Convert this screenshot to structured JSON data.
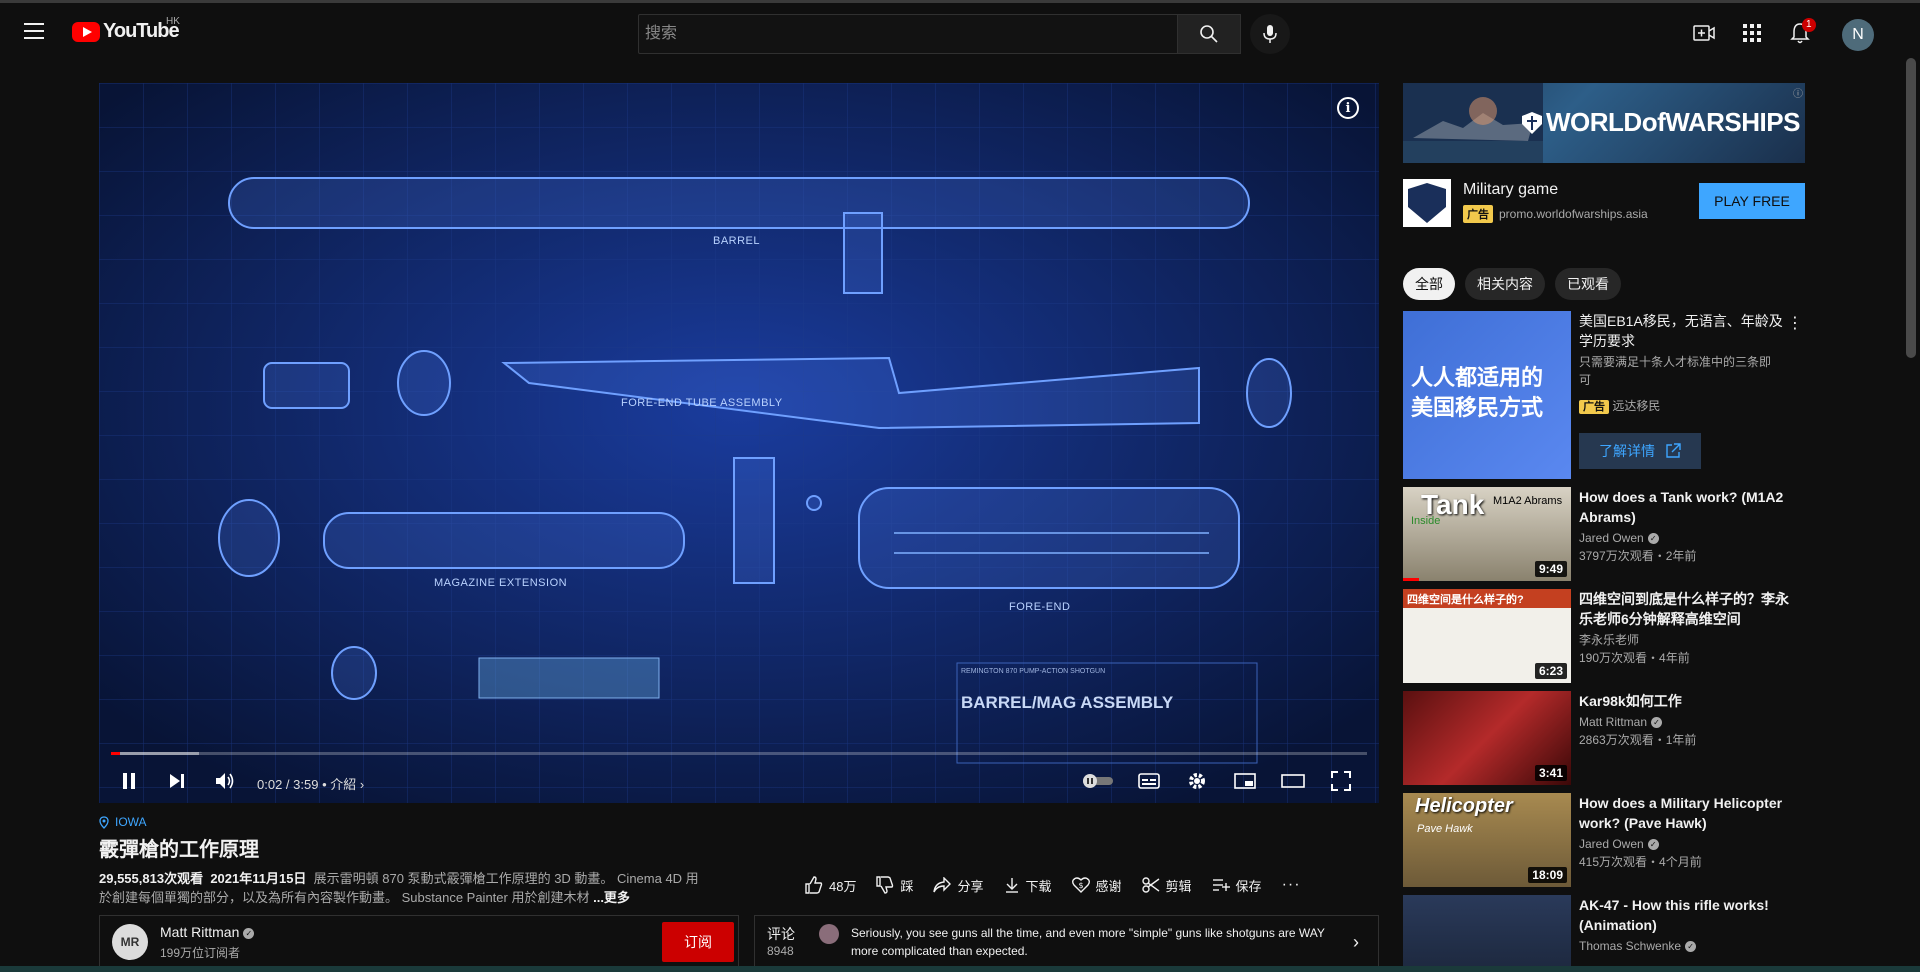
{
  "header": {
    "menu_icon": "hamburger-menu-icon",
    "logo_text": "YouTube",
    "country_code": "HK",
    "search_placeholder": "搜索",
    "notification_count": "1",
    "avatar_letter": "N"
  },
  "player": {
    "info_icon": "i",
    "blueprint_labels": {
      "barrel": "BARREL",
      "fore_end_tube": "FORE-END TUBE ASSEMBLY",
      "magazine_extension": "MAGAZINE EXTENSION",
      "fore_end": "FORE-END",
      "title_block_sub": "REMINGTON 870 PUMP-ACTION SHOTGUN",
      "title_block": "BARREL/MAG ASSEMBLY"
    },
    "time_current": "0:02",
    "time_total": "3:59",
    "chapter": "• 介紹",
    "progress_played": 0.007,
    "progress_loaded": 0.07
  },
  "video": {
    "location": "IOWA",
    "title": "霰彈槍的工作原理",
    "views": "29,555,813次观看",
    "date": "2021年11月15日",
    "description": "展示雷明頓 870 泵動式霰彈槍工作原理的 3D 動畫。 Cinema 4D 用於創建每個單獨的部分，以及為所有內容製作動畫。 Substance Painter 用於創建木材",
    "more_label": "...更多",
    "actions": {
      "like": "48万",
      "dislike": "踩",
      "share": "分享",
      "download": "下载",
      "thanks": "感谢",
      "clip": "剪辑",
      "save": "保存"
    }
  },
  "channel": {
    "name": "Matt Rittman",
    "subscribers": "199万位订阅者",
    "avatar_text": "MR",
    "subscribe_label": "订阅"
  },
  "comments": {
    "label": "评论",
    "count": "8948",
    "top_comment": "Seriously, you see guns all the time, and even more \"simple\" guns like shotguns are WAY more complicated than expected."
  },
  "ad": {
    "banner_text": "WORLDofWARSHIPS",
    "title": "Military game",
    "tag": "广告",
    "url": "promo.worldofwarships.asia",
    "cta": "PLAY FREE"
  },
  "chips": [
    "全部",
    "相关内容",
    "已观看"
  ],
  "promo": {
    "title": "美国EB1A移民，无语言、年龄及学历要求",
    "subtitle": "只需要满足十条人才标准中的三条即可",
    "tag": "广告",
    "advertiser": "远达移民",
    "thumb_text": "人人都适用的美国移民方式",
    "cta": "了解详情"
  },
  "recommendations": [
    {
      "title": "How does a Tank work? (M1A2 Abrams)",
      "channel": "Jared Owen",
      "meta": "3797万次观看・2年前",
      "duration": "9:49",
      "thumb_text": "Tank",
      "thumb_sub": "M1A2 Abrams",
      "thumb_inside": "Inside"
    },
    {
      "title": "四维空间到底是什么样子的？李永乐老师6分钟解释高维空间",
      "channel": "李永乐老师",
      "meta": "190万次观看・4年前",
      "duration": "6:23",
      "thumb_text": "四维空间是什么样子的?"
    },
    {
      "title": "Kar98k如何工作",
      "channel": "Matt Rittman",
      "meta": "2863万次观看・1年前",
      "duration": "3:41"
    },
    {
      "title": "How does a Military Helicopter work? (Pave Hawk)",
      "channel": "Jared Owen",
      "meta": "415万次观看・4个月前",
      "duration": "18:09",
      "thumb_text": "Helicopter",
      "thumb_sub": "Pave Hawk"
    },
    {
      "title": "AK-47 - How this rifle works! (Animation)",
      "channel": "Thomas Schwenke",
      "meta": ""
    }
  ],
  "colors": {
    "background": "#0f0f0f",
    "accent_red": "#ff0000",
    "subscribe_red": "#cc0000",
    "link_blue": "#3ea6ff",
    "ad_yellow": "#f2c94c"
  }
}
